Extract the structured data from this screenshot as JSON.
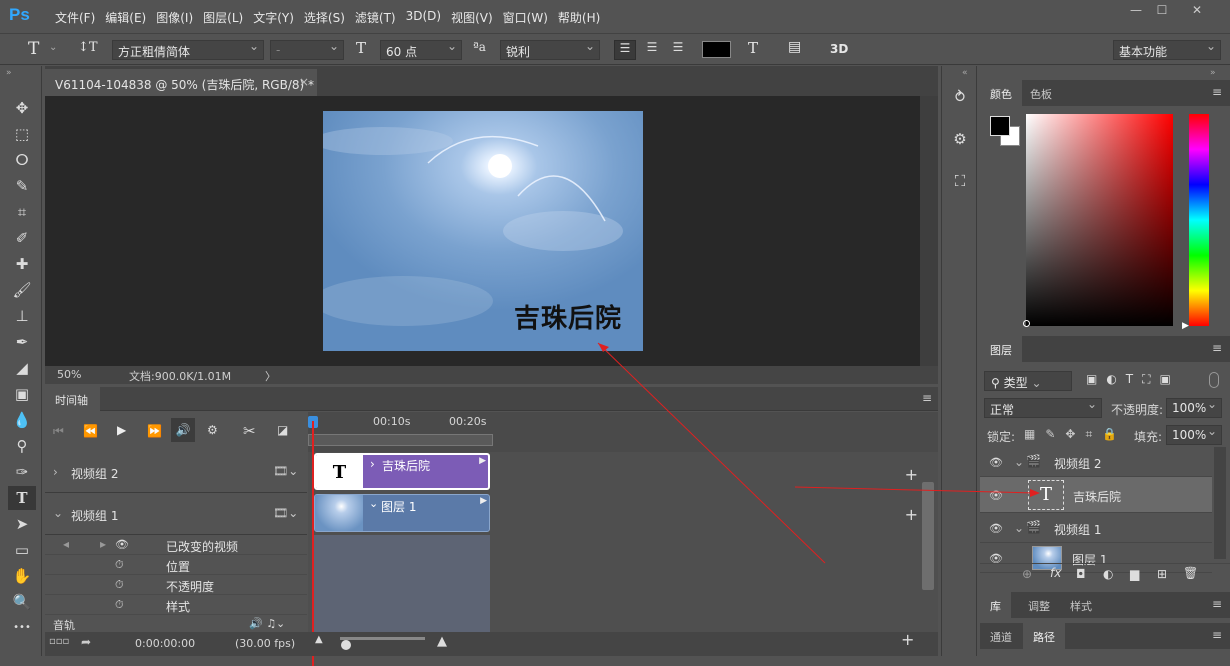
{
  "app": {
    "logo": "Ps",
    "colors": {
      "accent": "#31a8ff",
      "panel": "#535353",
      "dark": "#282828",
      "purple_clip": "#7c5cb6",
      "blue_clip": "#5b7aa8",
      "red": "#e02020"
    }
  },
  "menu": [
    "文件(F)",
    "编辑(E)",
    "图像(I)",
    "图层(L)",
    "文字(Y)",
    "选择(S)",
    "滤镜(T)",
    "3D(D)",
    "视图(V)",
    "窗口(W)",
    "帮助(H)"
  ],
  "window_buttons": [
    "—",
    "☐",
    "✕"
  ],
  "options": {
    "tool_icon": "T",
    "orient_icon": "↕T",
    "font_family": "方正粗倩简体",
    "font_style": "-",
    "size_icon": "T",
    "font_size": "60 点",
    "aa_icon": "ªa",
    "aa_mode": "锐利",
    "color": "#000000",
    "warp_icon": "T",
    "panel_icon": "▤",
    "three_d": "3D",
    "workspace": "基本功能"
  },
  "tools": [
    "✥",
    "⬚",
    "ⵔ",
    "✎",
    "⌗",
    "✐",
    "✚",
    "🖌",
    "⊥",
    "✒",
    "◢",
    "▣",
    "💧",
    "⚲",
    "✑",
    "T",
    "➤",
    "▭",
    "✋",
    "🔍",
    "•••"
  ],
  "document": {
    "tab_title": "V61104-104838 @ 50% (吉珠后院, RGB/8) *",
    "close": "×",
    "canvas_text": "吉珠后院",
    "zoom": "50%",
    "doc_info": "文档:900.0K/1.01M",
    "chev": "〉"
  },
  "timeline": {
    "tab": "时间轴",
    "times": [
      "00:10s",
      "00:20s"
    ],
    "tracks": [
      {
        "label": "视频组 2",
        "clip": "吉珠后院",
        "thumb": "T"
      },
      {
        "label": "视频组 1",
        "clip": "图层 1"
      }
    ],
    "props": [
      "已改变的视频",
      "位置",
      "不透明度",
      "样式"
    ],
    "audio": "音轨",
    "timecode": "0:00:00:00",
    "fps": "(30.00 fps)",
    "plus": "+"
  },
  "icon_strip": [
    "⥁",
    "⚙",
    "⛶"
  ],
  "color_panel": {
    "tabs": [
      "颜色",
      "色板"
    ]
  },
  "layers_panel": {
    "tab": "图层",
    "filter": "类型",
    "blend": "正常",
    "opacity_label": "不透明度:",
    "opacity": "100%",
    "lock_label": "锁定:",
    "fill_label": "填充:",
    "fill": "100%",
    "layers": [
      {
        "name": "视频组 2",
        "type": "group"
      },
      {
        "name": "吉珠后院",
        "type": "text"
      },
      {
        "name": "视频组 1",
        "type": "group"
      },
      {
        "name": "图层 1",
        "type": "image"
      }
    ],
    "footer_icons": [
      "⊕",
      "fx",
      "◘",
      "◐",
      "▆",
      "⊞",
      "🗑"
    ]
  },
  "bottom_tabs": [
    [
      "库",
      "调整",
      "样式"
    ],
    [
      "通道",
      "路径"
    ]
  ]
}
